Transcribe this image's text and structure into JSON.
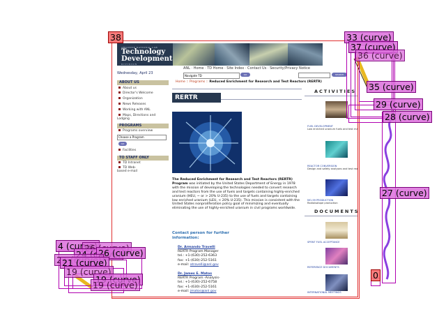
{
  "banner": {
    "lab": "ARGONNE NATIONAL LAB",
    "title_line1": "Technology",
    "title_line2": "Development",
    "division": "DIVISION"
  },
  "date": "Wednesday, April 23",
  "topnav": {
    "links": "ANL · Home · TD Home · Site Index · Contact Us · Security/Privacy Notice",
    "select_value": "Navigate TD",
    "go": "GO",
    "search_btn": "SEARCH"
  },
  "sidebar": {
    "about_head": "ABOUT US",
    "about_items": [
      "About us",
      "Director's Welcome",
      "Organization",
      "News Releases",
      "Working with ANL",
      "Maps, Directions and Lodging"
    ],
    "programs_head": "PROGRAMS",
    "programs_items": [
      "Programs overview"
    ],
    "program_select": "Choose a Program",
    "go": "GO",
    "facilities": "Facilities",
    "staff_head": "TO STAFF ONLY",
    "staff_items": [
      "TD Intranet",
      "TD Web-based e-mail"
    ]
  },
  "breadcrumb": {
    "prefix": "Home :: Programs :: ",
    "current": "Reduced Enrichment for Research and Test Reactors (RERTR)"
  },
  "main": {
    "tab": "RERTR",
    "desc_title": "The Reduced Enrichment for Research and Test Reactors (RERTR) Program",
    "desc_body": "was initiated by the United States Department of Energy in 1978 with the mission of developing the technologies needed to convert research and test reactors from the use of fuels and targets containing highly-enriched uranium (HEU, ~ or > 20% U-235) to the use of fuels and targets containing low enriched uranium (LEU, < 20% U-235). This mission is consistent with the United States nonproliferation policy goal of minimizing and eventually eliminating the use of highly-enriched uranium in civil programs worldwide.",
    "contact_head": "Contact person for further information:",
    "contacts": [
      {
        "name": "Dr. Armando Travelli",
        "role": "RERTR Program Manager",
        "tel": "tel.: +1-(630)-252-6363",
        "fax": "fax: +1-(630)-252-5161",
        "email_label": "e-mail:",
        "email": "atravelli@anl.gov"
      },
      {
        "name": "Dr. James E. Matos",
        "role": "RERTR Program -Analysis-",
        "tel": "tel.: +1-(630)-252-6758",
        "fax": "fax: +1-(630)-252-5161",
        "email_label": "e-mail:",
        "email": "jmatos@anl.gov"
      }
    ]
  },
  "right": {
    "activities_head": "ACTIVITIES",
    "activities": [
      {
        "title": "FUEL DEVELOPMENT",
        "caption": "Low enriched uranium fuels and test mate..."
      },
      {
        "title": "REACTOR CONVERSION",
        "caption": "Design and safety analyses and test reactors"
      },
      {
        "title": "MO-99 PRODUCTION",
        "caption": "Radioisotope production"
      }
    ],
    "documents_head": "DOCUMENTS",
    "documents": [
      {
        "title": "SPENT FUEL ACCEPTANCE"
      },
      {
        "title": "REFERENCE DOCUMENTS"
      },
      {
        "title": "INTERNATIONAL MEETINGS"
      }
    ]
  },
  "overlay": {
    "labels": {
      "t38": "38",
      "t33": "33 (curve)",
      "t37": "37 (curve)",
      "t36": "36 (curve)",
      "t35": "35 (curve)",
      "t29": "29 (curve)",
      "t28": "28 (curve)",
      "t27": "27 (curve)",
      "t0": "0",
      "t4": "4 (curve)",
      "t24": "24 (curve)",
      "t26": "26 (curve)",
      "t21": "21 (curve)",
      "t19": "19 (curve)"
    }
  },
  "colors": {
    "banner": "#27384f",
    "sidebar_head": "#c9c2a0",
    "link": "#1f3fa0",
    "crumb_accent": "#c04020",
    "overlay_magenta": "#b000b0",
    "overlay_tag": "#dc6edc",
    "overlay_red": "#f56e6e",
    "curve_purple": "#8a3fe0",
    "curve_yellow": "#e8b820"
  }
}
